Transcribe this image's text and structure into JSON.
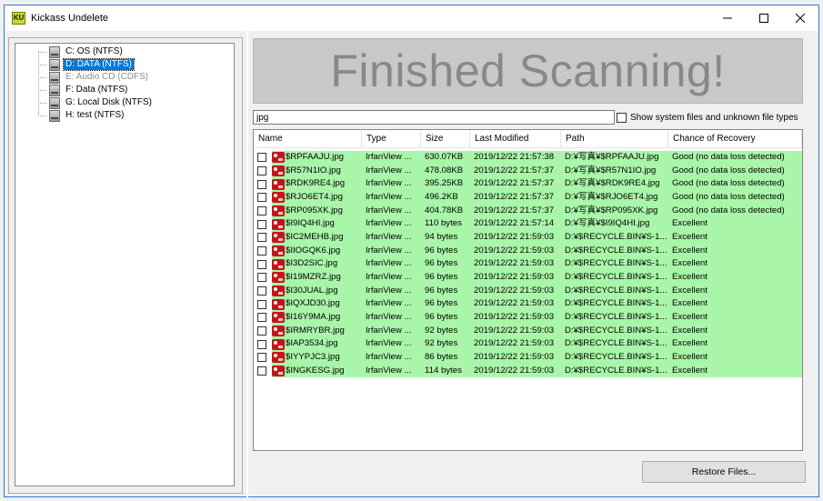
{
  "window": {
    "title": "Kickass Undelete",
    "app_icon_text": "KU"
  },
  "drives": [
    {
      "label": "C: OS (NTFS)",
      "selected": false,
      "disabled": false
    },
    {
      "label": "D: DATA (NTFS)",
      "selected": true,
      "disabled": false
    },
    {
      "label": "E: Audio CD (CDFS)",
      "selected": false,
      "disabled": true
    },
    {
      "label": "F: Data (NTFS)",
      "selected": false,
      "disabled": false
    },
    {
      "label": "G: Local Disk (NTFS)",
      "selected": false,
      "disabled": false
    },
    {
      "label": "H: test (NTFS)",
      "selected": false,
      "disabled": false
    }
  ],
  "banner": {
    "text": "Finished Scanning!"
  },
  "filter": {
    "value": "jpg",
    "show_system_label": "Show system files and unknown file types"
  },
  "columns": [
    "Name",
    "Type",
    "Size",
    "Last Modified",
    "Path",
    "Chance of Recovery"
  ],
  "rows": [
    [
      "$RPFAAJU.jpg",
      "IrfanView ...",
      "630.07KB",
      "2019/12/22 21:57:38",
      "D:¥写真¥$RPFAAJU.jpg",
      "Good (no data loss detected)"
    ],
    [
      "$R57N1IO.jpg",
      "IrfanView ...",
      "478.08KB",
      "2019/12/22 21:57:37",
      "D:¥写真¥$R57N1IO.jpg",
      "Good (no data loss detected)"
    ],
    [
      "$RDK9RE4.jpg",
      "IrfanView ...",
      "395.25KB",
      "2019/12/22 21:57:37",
      "D:¥写真¥$RDK9RE4.jpg",
      "Good (no data loss detected)"
    ],
    [
      "$RJO6ET4.jpg",
      "IrfanView ...",
      "496.2KB",
      "2019/12/22 21:57:37",
      "D:¥写真¥$RJO6ET4.jpg",
      "Good (no data loss detected)"
    ],
    [
      "$RP095XK.jpg",
      "IrfanView ...",
      "404.78KB",
      "2019/12/22 21:57:37",
      "D:¥写真¥$RP095XK.jpg",
      "Good (no data loss detected)"
    ],
    [
      "$I9IQ4HI.jpg",
      "IrfanView ...",
      "110 bytes",
      "2019/12/22 21:57:14",
      "D:¥写真¥$I9IQ4HI.jpg",
      "Excellent"
    ],
    [
      "$IC2MEHB.jpg",
      "IrfanView ...",
      "94 bytes",
      "2019/12/22 21:59:03",
      "D:¥$RECYCLE.BIN¥S-1...",
      "Excellent"
    ],
    [
      "$IIOGQK6.jpg",
      "IrfanView ...",
      "96 bytes",
      "2019/12/22 21:59:03",
      "D:¥$RECYCLE.BIN¥S-1...",
      "Excellent"
    ],
    [
      "$I3D2SIC.jpg",
      "IrfanView ...",
      "96 bytes",
      "2019/12/22 21:59:03",
      "D:¥$RECYCLE.BIN¥S-1...",
      "Excellent"
    ],
    [
      "$I19MZRZ.jpg",
      "IrfanView ...",
      "96 bytes",
      "2019/12/22 21:59:03",
      "D:¥$RECYCLE.BIN¥S-1...",
      "Excellent"
    ],
    [
      "$I30JUAL.jpg",
      "IrfanView ...",
      "96 bytes",
      "2019/12/22 21:59:03",
      "D:¥$RECYCLE.BIN¥S-1...",
      "Excellent"
    ],
    [
      "$IQXJD30.jpg",
      "IrfanView ...",
      "96 bytes",
      "2019/12/22 21:59:03",
      "D:¥$RECYCLE.BIN¥S-1...",
      "Excellent"
    ],
    [
      "$I16Y9MA.jpg",
      "IrfanView ...",
      "96 bytes",
      "2019/12/22 21:59:03",
      "D:¥$RECYCLE.BIN¥S-1...",
      "Excellent"
    ],
    [
      "$IRMRYBR.jpg",
      "IrfanView ...",
      "92 bytes",
      "2019/12/22 21:59:03",
      "D:¥$RECYCLE.BIN¥S-1...",
      "Excellent"
    ],
    [
      "$IAP3534.jpg",
      "IrfanView ...",
      "92 bytes",
      "2019/12/22 21:59:03",
      "D:¥$RECYCLE.BIN¥S-1...",
      "Excellent"
    ],
    [
      "$IYYPJC3.jpg",
      "IrfanView ...",
      "86 bytes",
      "2019/12/22 21:59:03",
      "D:¥$RECYCLE.BIN¥S-1...",
      "Excellent"
    ],
    [
      "$INGKESG.jpg",
      "IrfanView ...",
      "114 bytes",
      "2019/12/22 21:59:03",
      "D:¥$RECYCLE.BIN¥S-1...",
      "Excellent"
    ]
  ],
  "actions": {
    "restore_label": "Restore Files..."
  },
  "colors": {
    "recoverable_row": "#a9f5a9",
    "selection": "#0078d7",
    "banner_bg": "#c8c8c8",
    "banner_text": "#888888"
  },
  "icons": {
    "app": "kickass-undelete-app-icon",
    "drive": "drive-icon",
    "file": "irfanview-image-icon",
    "minimize": "minimize-icon",
    "maximize": "maximize-icon",
    "close": "close-icon"
  }
}
